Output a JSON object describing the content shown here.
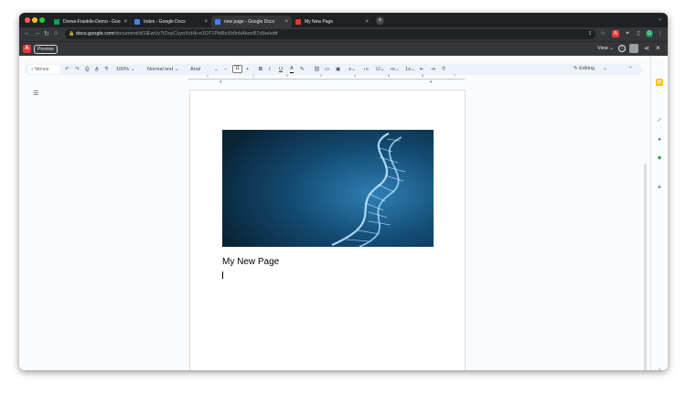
{
  "browser": {
    "tabs": [
      {
        "title": "Drews-Franklin-Demo - Goo",
        "favicon_color": "#0f9d58"
      },
      {
        "title": "Index - Google Docs",
        "favicon_color": "#4285f4"
      },
      {
        "title": "new page - Google Docs",
        "favicon_color": "#4285f4"
      },
      {
        "title": "My New Page",
        "favicon_color": "#e53935"
      }
    ],
    "new_tab": "+",
    "url_host": "docs.google.com",
    "url_path": "/document/d/1lEwUy7lOuyCuyoXcHb-n1OT1Pb8IzXh9nkAbexB7x5w/edit"
  },
  "extension": {
    "logo": "A",
    "preview_label": "Preview",
    "view_label": "View"
  },
  "toolbar": {
    "menus": "Menus",
    "zoom": "100%",
    "style": "Normal text",
    "font": "Arial",
    "font_size": "11",
    "mode": "Editing"
  },
  "ruler": {
    "marks": [
      "1",
      "1",
      "2",
      "3",
      "4",
      "5",
      "6",
      "7"
    ]
  },
  "document": {
    "heading": "My New Page"
  },
  "colors": {
    "chrome_dark": "#202124",
    "chrome_mid": "#35363a",
    "docs_bg": "#f9fbfd",
    "toolbar_bg": "#edf2fa",
    "dna_blue": "#1a5a86"
  }
}
